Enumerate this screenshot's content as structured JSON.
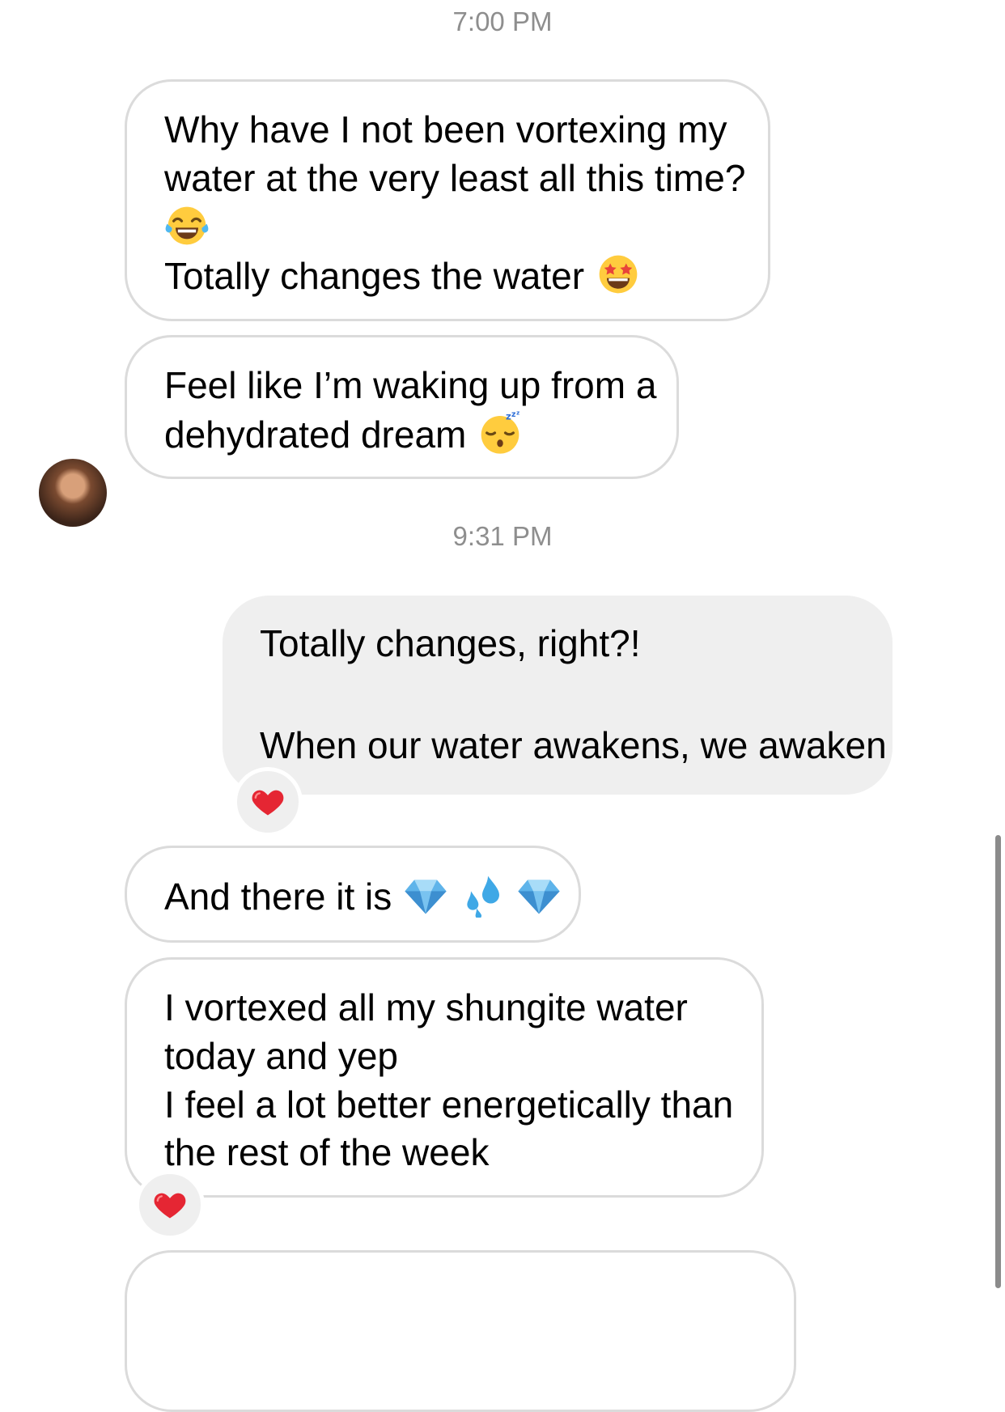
{
  "timestamps": {
    "first": "7:00 PM",
    "second": "9:31 PM"
  },
  "messages": {
    "m1": {
      "line1": "Why have I not been vortexing my",
      "line2": "water at the very least all this time?",
      "emoji_line3": "face-with-tears-of-joy",
      "line4": "Totally changes the water",
      "emoji_line4": "star-struck"
    },
    "m2": {
      "line1": "Feel like I’m waking up from a",
      "line2": "dehydrated dream",
      "emoji_line2": "sleeping-face"
    },
    "m3": {
      "line1": "Totally changes, right?!",
      "line2": "When our water awakens, we awaken",
      "reaction": "red-heart"
    },
    "m4": {
      "line1": "And there it is",
      "emojis": [
        "gem-stone",
        "sweat-droplets",
        "gem-stone"
      ]
    },
    "m5": {
      "line1": "I vortexed all my shungite water",
      "line2": "today and yep",
      "line3": "I feel a lot better energetically than",
      "line4": "the rest of the week",
      "reaction": "red-heart"
    }
  },
  "colors": {
    "incoming_bubble_border": "#dbdbdb",
    "outgoing_bubble_bg": "#efefef",
    "timestamp_text": "#8e8e8e",
    "heart": "#e0245e"
  }
}
